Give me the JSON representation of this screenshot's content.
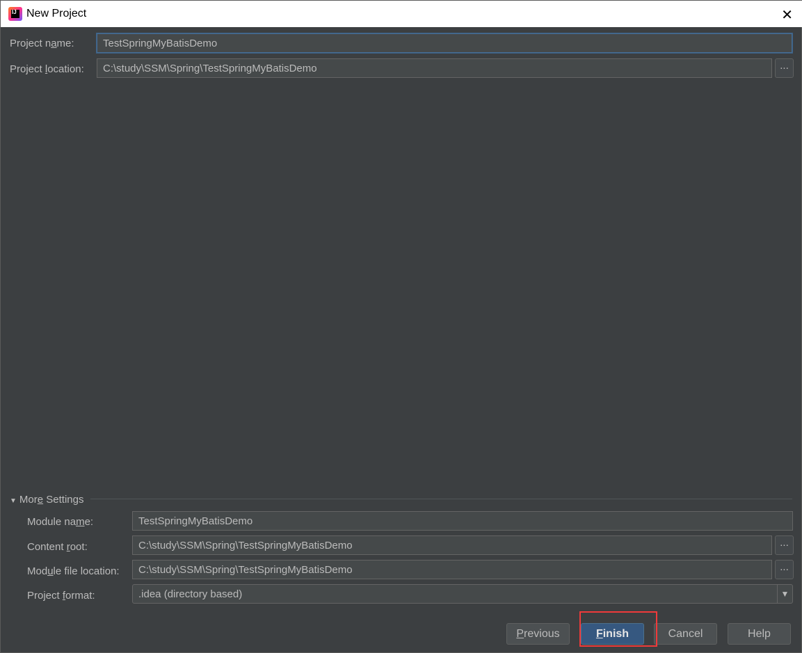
{
  "window": {
    "title": "New Project",
    "logo_text": "IJ",
    "close_icon": "close-icon"
  },
  "project_name": {
    "label": {
      "pre": "Project n",
      "key": "a",
      "post": "me:"
    },
    "value": "TestSpringMyBatisDemo"
  },
  "project_location": {
    "label": {
      "pre": "Project ",
      "key": "l",
      "post": "ocation:"
    },
    "value": "C:\\study\\SSM\\Spring\\TestSpringMyBatisDemo",
    "browse": "..."
  },
  "more_settings": {
    "label": {
      "pre": "Mor",
      "key": "e",
      "post": " Settings"
    },
    "expanded": true
  },
  "module_name": {
    "label": {
      "pre": "Module na",
      "key": "m",
      "post": "e:"
    },
    "value": "TestSpringMyBatisDemo"
  },
  "content_root": {
    "label": {
      "pre": "Content ",
      "key": "r",
      "post": "oot:"
    },
    "value": "C:\\study\\SSM\\Spring\\TestSpringMyBatisDemo",
    "browse": "..."
  },
  "module_file_location": {
    "label": {
      "pre": "Mod",
      "key": "u",
      "post": "le file location:"
    },
    "value": "C:\\study\\SSM\\Spring\\TestSpringMyBatisDemo",
    "browse": "..."
  },
  "project_format": {
    "label": {
      "pre": "Project ",
      "key": "f",
      "post": "ormat:"
    },
    "value": ".idea (directory based)"
  },
  "buttons": {
    "previous": {
      "key": "P",
      "rest": "revious"
    },
    "finish": {
      "key": "F",
      "rest": "inish"
    },
    "cancel": "Cancel",
    "help": "Help"
  },
  "colors": {
    "highlight": "#f03a3a",
    "primary": "#365880"
  }
}
